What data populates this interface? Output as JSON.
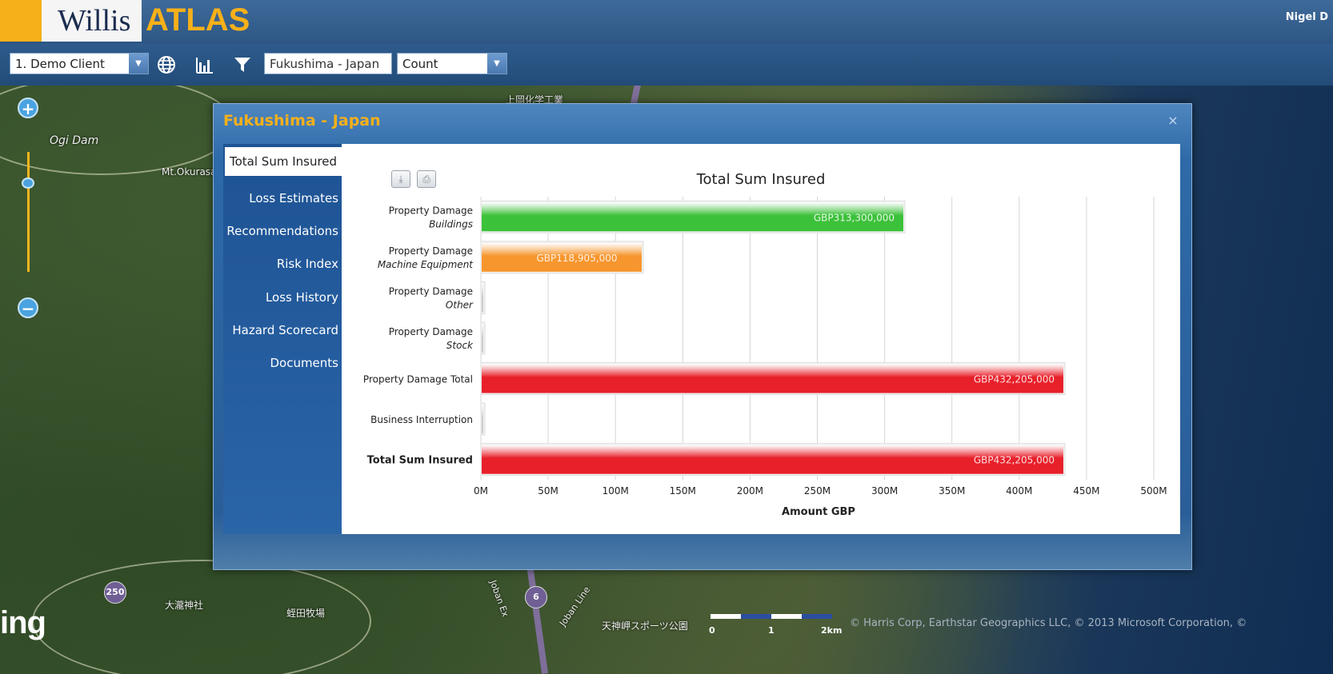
{
  "header": {
    "logo_willis": "Willis",
    "logo_atlas": "ATLAS",
    "user_name": "Nigel D"
  },
  "toolbar": {
    "client_select": "1. Demo Client",
    "location_input": "Fukushima - Japan",
    "metric_select": "Count",
    "icons": [
      "globe-icon",
      "bar-chart-icon",
      "filter-icon"
    ]
  },
  "map": {
    "labels": {
      "ogi_dam": "Ogi Dam",
      "mt_okurasan": "Mt.Okurasan",
      "chemical": "上岡化学工業",
      "shrine": "大瀧神社",
      "ranch": "蛭田牧場",
      "park": "天神岬スポーツ公園",
      "joban": "Joban Ex",
      "joban_line": "Joban Line"
    },
    "route_markers": [
      "250",
      "6"
    ],
    "scale": {
      "labels": [
        "0",
        "1",
        "2km"
      ]
    },
    "bing_logo": "ing",
    "copyright": "© Harris Corp, Earthstar Geographics LLC, © 2013 Microsoft Corporation, ©"
  },
  "modal": {
    "title": "Fukushima - Japan",
    "close_label": "×",
    "tabs": [
      {
        "label": "Total Sum Insured",
        "active": true
      },
      {
        "label": "Loss Estimates",
        "active": false
      },
      {
        "label": "Recommendations",
        "active": false
      },
      {
        "label": "Risk Index",
        "active": false
      },
      {
        "label": "Loss History",
        "active": false
      },
      {
        "label": "Hazard Scorecard",
        "active": false
      },
      {
        "label": "Documents",
        "active": false
      }
    ],
    "chart_buttons": [
      "download-icon",
      "print-icon"
    ]
  },
  "chart_data": {
    "type": "bar",
    "orientation": "horizontal",
    "title": "Total Sum Insured",
    "xlabel": "Amount GBP",
    "xlim": [
      0,
      500000000
    ],
    "xticks": [
      "0M",
      "50M",
      "100M",
      "150M",
      "200M",
      "250M",
      "300M",
      "350M",
      "400M",
      "450M",
      "500M"
    ],
    "grid": true,
    "categories": [
      {
        "line1": "Property Damage",
        "line2": "Buildings",
        "bold": false
      },
      {
        "line1": "Property Damage",
        "line2": "Machine Equipment",
        "bold": false
      },
      {
        "line1": "Property Damage",
        "line2": "Other",
        "bold": false
      },
      {
        "line1": "Property Damage",
        "line2": "Stock",
        "bold": false
      },
      {
        "line1": "Property Damage Total",
        "line2": "",
        "bold": false
      },
      {
        "line1": "Business Interruption",
        "line2": "",
        "bold": false
      },
      {
        "line1": "Total Sum Insured",
        "line2": "",
        "bold": true
      }
    ],
    "values": [
      313300000,
      118905000,
      0,
      0,
      432205000,
      0,
      432205000
    ],
    "data_labels": [
      "GBP313,300,000",
      "GBP118,905,000",
      "",
      "",
      "GBP432,205,000",
      "",
      "GBP432,205,000"
    ],
    "colors": [
      "#3cc13a",
      "#f7962e",
      "#cccccc",
      "#cccccc",
      "#e8202a",
      "#cccccc",
      "#e8202a"
    ]
  }
}
